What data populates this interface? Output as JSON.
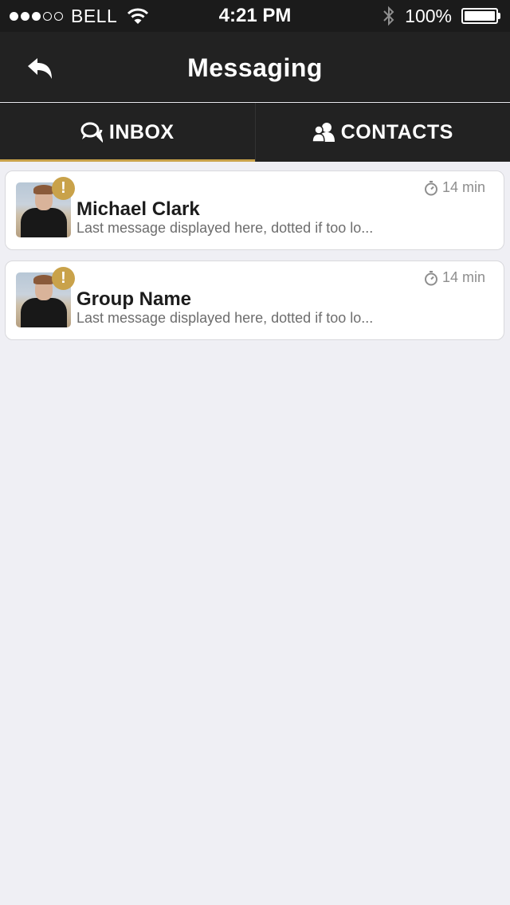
{
  "status_bar": {
    "carrier": "BELL",
    "time": "4:21 PM",
    "battery": "100%",
    "signal_bars_filled": 3,
    "signal_bars_total": 5
  },
  "nav": {
    "title": "Messaging",
    "back_icon": "back-arrow-icon"
  },
  "tabs": [
    {
      "label": "INBOX",
      "icon": "chat-bubbles-icon",
      "active": true
    },
    {
      "label": "CONTACTS",
      "icon": "people-icon",
      "active": false
    }
  ],
  "conversations": [
    {
      "name": "Michael Clark",
      "message": "Last message displayed here, dotted if too lo...",
      "time": "14 min",
      "badge": "!"
    },
    {
      "name": "Group Name",
      "message": "Last message displayed here, dotted if too lo...",
      "time": "14 min",
      "badge": "!"
    }
  ],
  "colors": {
    "accent": "#c9a24a",
    "header_bg": "#222222",
    "page_bg": "#efeff4"
  }
}
